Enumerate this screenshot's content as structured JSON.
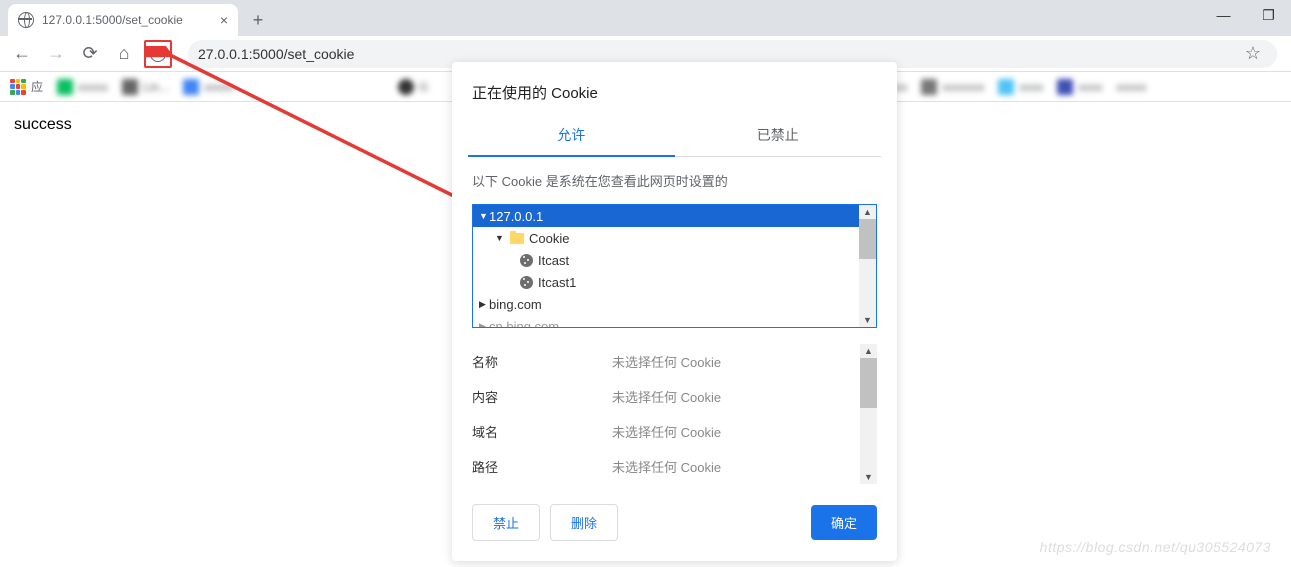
{
  "tab": {
    "title": "127.0.0.1:5000/set_cookie"
  },
  "address": {
    "url": "27.0.0.1:5000/set_cookie"
  },
  "bookmarks": {
    "apps_label": "应",
    "item_lin": "Lin..."
  },
  "page": {
    "body_text": "success"
  },
  "popover": {
    "title": "正在使用的 Cookie",
    "tabs": {
      "allowed": "允许",
      "blocked": "已禁止"
    },
    "desc": "以下 Cookie 是系统在您查看此网页时设置的",
    "tree": {
      "root": "127.0.0.1",
      "folder": "Cookie",
      "cookie1": "Itcast",
      "cookie2": "Itcast1",
      "domain2": "bing.com",
      "domain3": "cn.bing.com"
    },
    "details": {
      "name_label": "名称",
      "content_label": "内容",
      "domain_label": "域名",
      "path_label": "路径",
      "no_selection": "未选择任何 Cookie"
    },
    "buttons": {
      "block": "禁止",
      "remove": "删除",
      "ok": "确定"
    }
  },
  "watermark": "https://blog.csdn.net/qu305524073"
}
